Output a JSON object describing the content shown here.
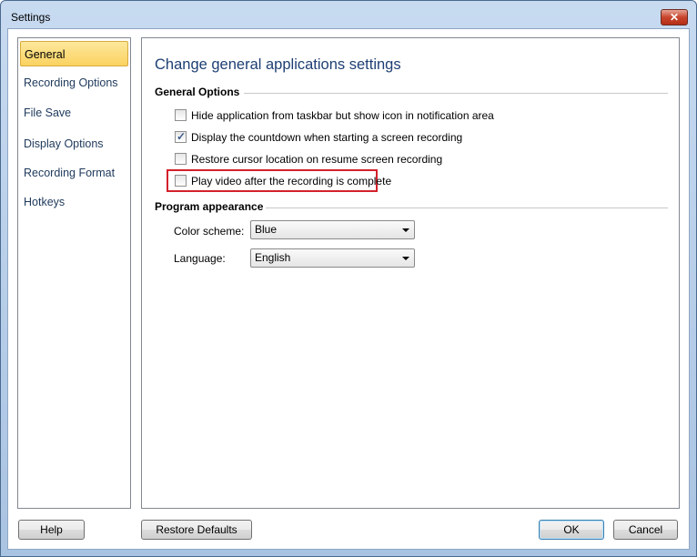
{
  "window": {
    "title": "Settings",
    "close_icon": "close-icon"
  },
  "sidebar": {
    "items": [
      {
        "label": "General",
        "selected": true
      },
      {
        "label": "Recording Options"
      },
      {
        "label": "File Save"
      },
      {
        "label": "Display Options"
      },
      {
        "label": "Recording Format"
      },
      {
        "label": "Hotkeys"
      }
    ]
  },
  "main": {
    "heading": "Change general applications settings",
    "general_options": {
      "label": "General Options",
      "options": [
        {
          "label": "Hide application from taskbar but show icon in notification area",
          "checked": false
        },
        {
          "label": "Display the countdown when starting a screen recording",
          "checked": true
        },
        {
          "label": "Restore cursor location on resume screen recording",
          "checked": false
        },
        {
          "label": "Play video after the recording is complete",
          "checked": false,
          "highlighted": true
        }
      ]
    },
    "program_appearance": {
      "label": "Program appearance",
      "color_scheme": {
        "label": "Color scheme:",
        "value": "Blue"
      },
      "language": {
        "label": "Language:",
        "value": "English"
      }
    }
  },
  "footer": {
    "help": "Help",
    "restore_defaults": "Restore Defaults",
    "ok": "OK",
    "cancel": "Cancel"
  },
  "colors": {
    "highlight_box": "#d3212b",
    "selected_nav": "#fbd260",
    "heading": "#1e3f73"
  }
}
